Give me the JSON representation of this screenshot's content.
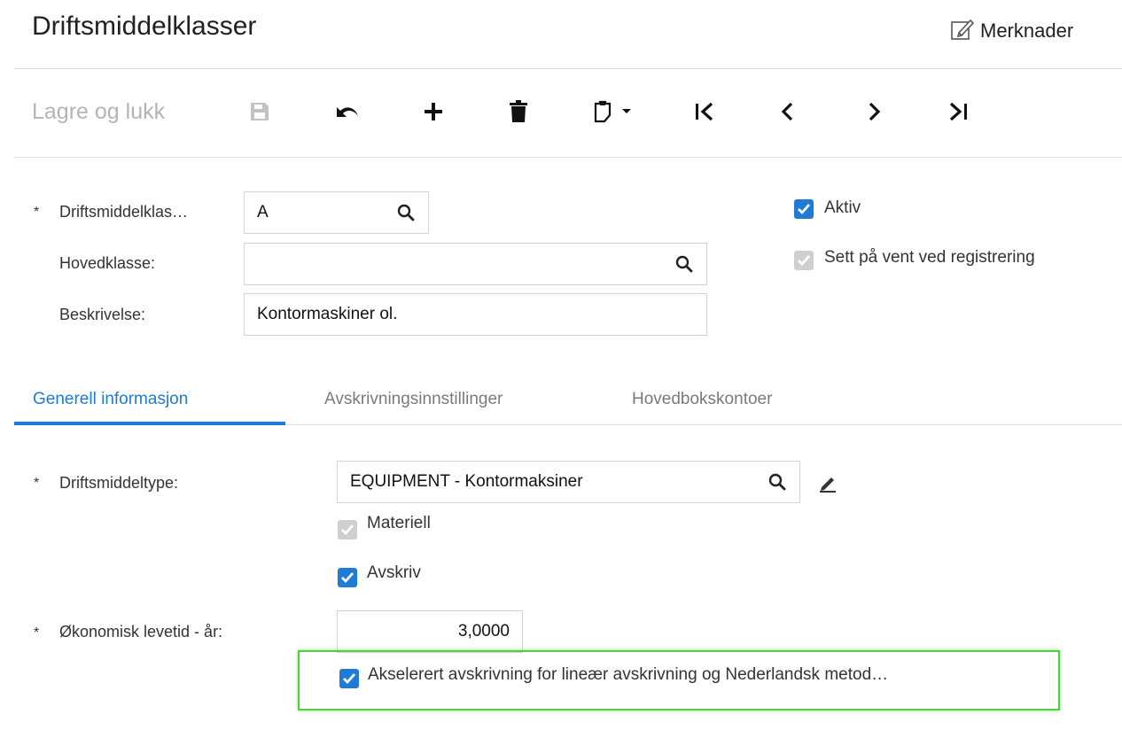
{
  "header": {
    "title": "Driftsmiddelklasser",
    "notes_label": "Merknader"
  },
  "toolbar": {
    "save_close_label": "Lagre og lukk",
    "icons": [
      "save-icon",
      "undo-icon",
      "add-icon",
      "delete-icon",
      "clipboard-icon",
      "first-record-icon",
      "previous-icon",
      "next-icon",
      "last-record-icon"
    ]
  },
  "form": {
    "class_id": {
      "label": "Driftsmiddelklas…",
      "value": "A",
      "required": "*"
    },
    "parent_class": {
      "label": "Hovedklasse:",
      "value": ""
    },
    "description": {
      "label": "Beskrivelse:",
      "value": "Kontormaskiner ol."
    },
    "active": {
      "label": "Aktiv",
      "checked": true
    },
    "hold_on_entry": {
      "label": "Sett på vent ved registrering",
      "checked": true,
      "disabled": true
    }
  },
  "tabs": [
    {
      "label": "Generell informasjon",
      "active": true
    },
    {
      "label": "Avskrivningsinnstillinger",
      "active": false
    },
    {
      "label": "Hovedbokskontoer",
      "active": false
    }
  ],
  "general": {
    "asset_type": {
      "label": "Driftsmiddeltype:",
      "value": "EQUIPMENT - Kontormaksiner",
      "required": "*"
    },
    "tangible": {
      "label": "Materiell",
      "checked": true,
      "disabled": true
    },
    "depreciate": {
      "label": "Avskriv",
      "checked": true
    },
    "useful_life": {
      "label": "Økonomisk levetid - år:",
      "value": "3,0000",
      "required": "*"
    },
    "accelerated": {
      "label": "Akselerert avskrivning for lineær avskrivning og Nederlandsk metod…",
      "checked": true
    }
  },
  "colors": {
    "accent": "#1e7bd6",
    "highlight": "#4cd23d",
    "disabled_text": "#b4b4b4"
  }
}
